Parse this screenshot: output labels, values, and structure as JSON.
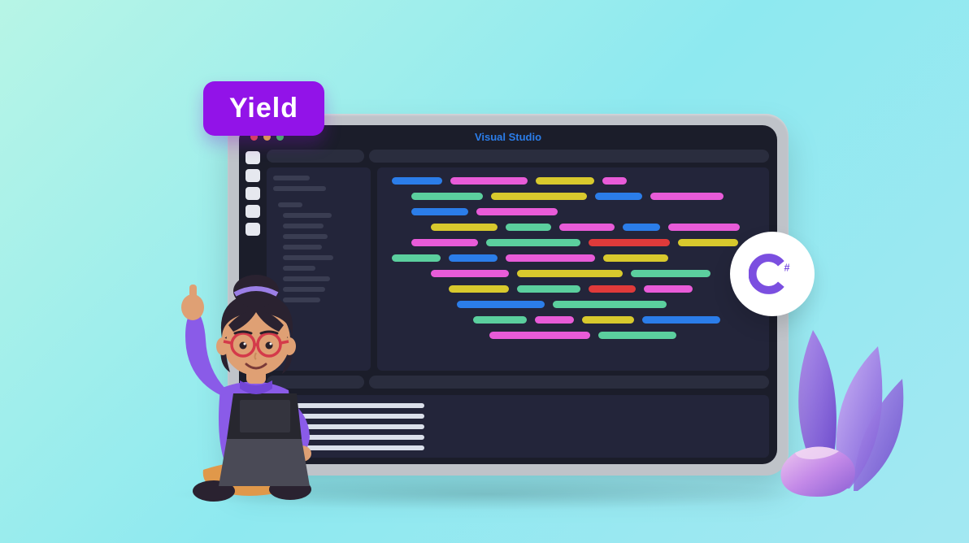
{
  "badge": {
    "label": "Yield"
  },
  "window": {
    "title": "Visual Studio"
  },
  "csharp": {
    "symbol": "C#"
  },
  "colors": {
    "pink": "#e85bd8",
    "yellow": "#d8c92d",
    "blue": "#2b7de9",
    "green": "#5bcf9e",
    "red": "#e03a3a"
  }
}
